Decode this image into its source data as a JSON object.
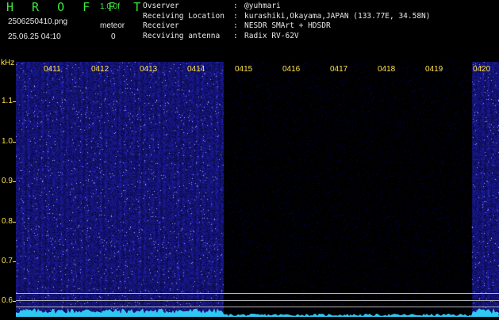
{
  "header": {
    "app_title": "H R O F F T",
    "version": "1.0.0f",
    "file_name": "2506250410.png",
    "mode": "meteor",
    "timestamp": "25.06.25 04:10",
    "count": "0"
  },
  "station": [
    {
      "label": "Ovserver",
      "value": "@yuhmari"
    },
    {
      "label": "Receiving Location",
      "value": "kurashiki,Okayama,JAPAN (133.77E, 34.58N)"
    },
    {
      "label": "Receiver",
      "value": "NESDR SMArt + HDSDR"
    },
    {
      "label": "Recviving antenna",
      "value": "Radix RV-62V"
    }
  ],
  "axis": {
    "unit": "kHz",
    "y_ticks": [
      "1.1",
      "1.0",
      "0.9",
      "0.8",
      "0.7",
      "0.6"
    ],
    "time_ticks": [
      "0411",
      "0412",
      "0413",
      "0414",
      "0415",
      "0416",
      "0417",
      "0418",
      "0419",
      "0420"
    ]
  },
  "colors": {
    "title_green": "#3ee83e",
    "axis_yellow": "#ffe14a",
    "noise_blue": "#1a1aa0",
    "waveform_cyan": "#2ec8f0"
  }
}
